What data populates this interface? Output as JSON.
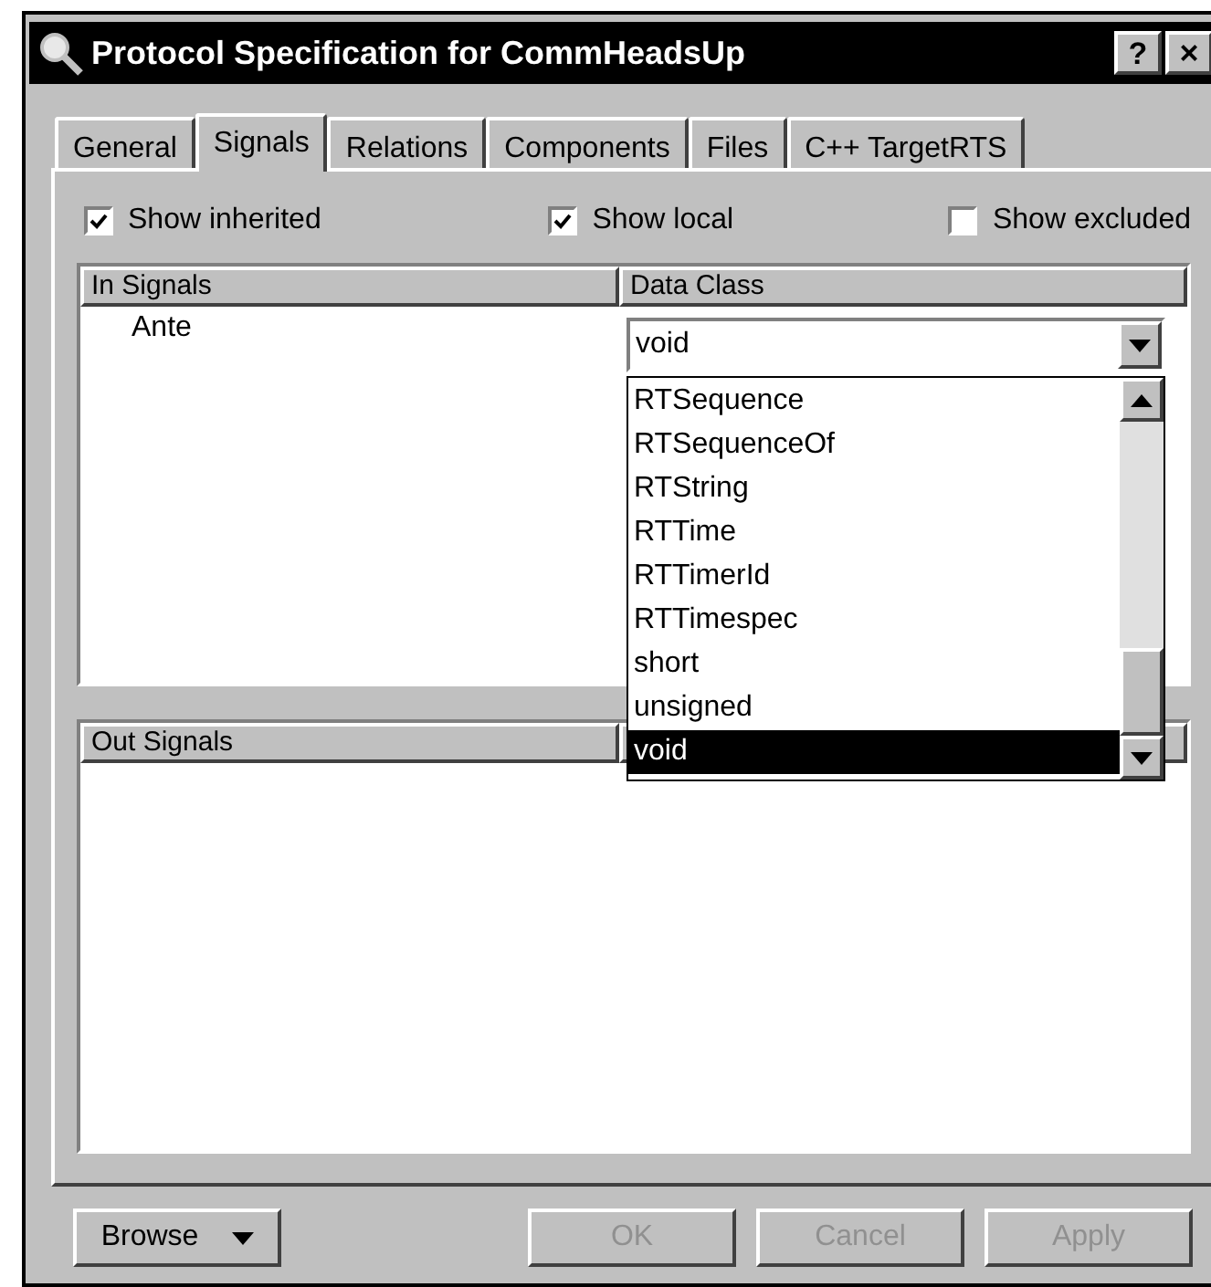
{
  "window": {
    "title": "Protocol Specification for CommHeadsUp",
    "help_button": "?",
    "close_button": "×"
  },
  "tabs": [
    {
      "label": "General",
      "selected": false
    },
    {
      "label": "Signals",
      "selected": true
    },
    {
      "label": "Relations",
      "selected": false
    },
    {
      "label": "Components",
      "selected": false
    },
    {
      "label": "Files",
      "selected": false
    },
    {
      "label": "C++ TargetRTS",
      "selected": false
    }
  ],
  "filters": [
    {
      "label": "Show inherited",
      "checked": true
    },
    {
      "label": "Show local",
      "checked": true
    },
    {
      "label": "Show excluded",
      "checked": false
    }
  ],
  "in_signals": {
    "columns": [
      "In Signals",
      "Data Class"
    ],
    "rows": [
      {
        "name": "Ante"
      }
    ]
  },
  "data_class_combo": {
    "value": "void",
    "items": [
      {
        "label": "RTSequence",
        "selected": false
      },
      {
        "label": "RTSequenceOf",
        "selected": false
      },
      {
        "label": "RTString",
        "selected": false
      },
      {
        "label": "RTTime",
        "selected": false
      },
      {
        "label": "RTTimerId",
        "selected": false
      },
      {
        "label": "RTTimespec",
        "selected": false
      },
      {
        "label": "short",
        "selected": false
      },
      {
        "label": "unsigned",
        "selected": false
      },
      {
        "label": "void",
        "selected": true
      }
    ]
  },
  "out_signals": {
    "columns": [
      "Out Signals"
    ]
  },
  "buttons": [
    {
      "label": "Browse",
      "kind": "menu",
      "disabled": false
    },
    {
      "label": "OK",
      "kind": "plain",
      "disabled": true
    },
    {
      "label": "Cancel",
      "kind": "plain",
      "disabled": true
    },
    {
      "label": "Apply",
      "kind": "plain",
      "disabled": true
    }
  ]
}
